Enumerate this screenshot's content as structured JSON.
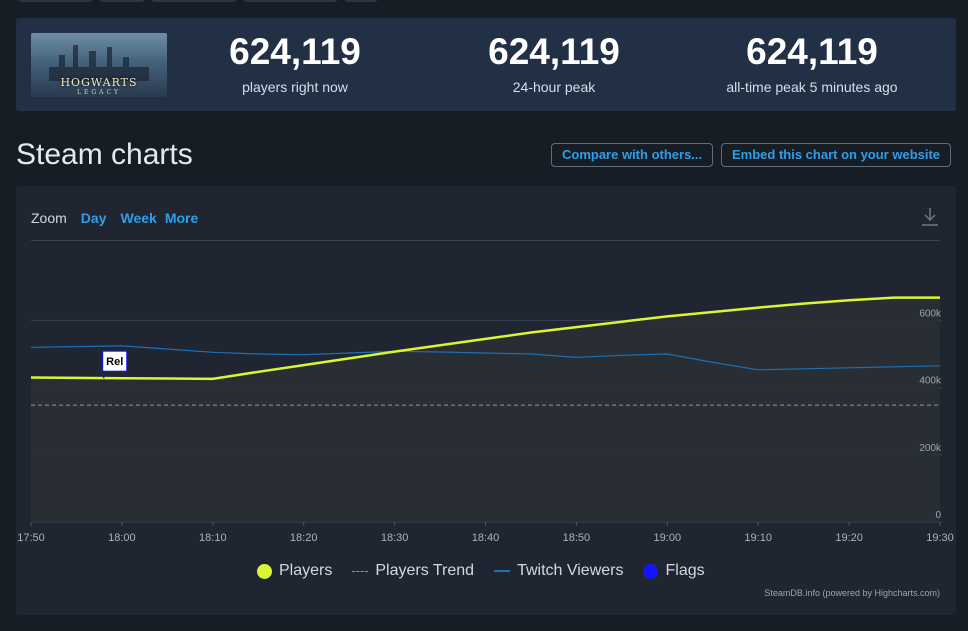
{
  "stats": [
    {
      "value": "624,119",
      "label": "players right now"
    },
    {
      "value": "624,119",
      "label": "24-hour peak"
    },
    {
      "value": "624,119",
      "label": "all-time peak 5 minutes ago"
    }
  ],
  "game": {
    "logo_text": "HOGWARTS",
    "logo_sub": "LEGACY"
  },
  "section_title": "Steam charts",
  "buttons": {
    "compare": "Compare with others...",
    "embed": "Embed this chart on your website"
  },
  "zoom": {
    "label": "Zoom",
    "day": "Day",
    "week": "Week",
    "more": "More"
  },
  "icons": {
    "download": "download-icon"
  },
  "colors": {
    "players": "#d9f533",
    "twitch": "#1d6fb4",
    "trend": "#8b97a3",
    "flags": "#1414ff",
    "accent": "#2f9ee8"
  },
  "chart_data": {
    "type": "line",
    "x": [
      "17:50",
      "17:55",
      "18:00",
      "18:05",
      "18:10",
      "18:15",
      "18:20",
      "18:25",
      "18:30",
      "18:35",
      "18:40",
      "18:45",
      "18:50",
      "18:55",
      "19:00",
      "19:05",
      "19:10",
      "19:15",
      "19:20",
      "19:25",
      "19:30"
    ],
    "series": [
      {
        "name": "Players",
        "values": [
          430000,
          429000,
          428000,
          427000,
          426000,
          447000,
          467000,
          487000,
          507000,
          526000,
          545000,
          564000,
          580000,
          596000,
          612000,
          625000,
          638000,
          650000,
          660000,
          668000,
          624119
        ]
      },
      {
        "name": "Twitch Viewers",
        "values": [
          520000,
          522000,
          524000,
          515000,
          505000,
          500000,
          498000,
          503000,
          508000,
          506000,
          503000,
          500000,
          490000,
          496000,
          500000,
          475000,
          453000,
          456000,
          459000,
          462000,
          465000
        ]
      },
      {
        "name": "Players Trend",
        "values": [
          348000,
          348000,
          348000,
          348000,
          348000,
          348000,
          348000,
          348000,
          348000,
          348000,
          348000,
          348000,
          348000,
          348000,
          348000,
          348000,
          348000,
          348000,
          348000,
          348000,
          348000
        ]
      }
    ],
    "flags": [
      {
        "x": "17:58",
        "label": "Rel"
      }
    ],
    "legend": [
      "Players",
      "Players Trend",
      "Twitch Viewers",
      "Flags"
    ],
    "x_ticks": [
      "17:50",
      "18:00",
      "18:10",
      "18:20",
      "18:30",
      "18:40",
      "18:50",
      "19:00",
      "19:10",
      "19:20",
      "19:30"
    ],
    "y_ticks": [
      "0",
      "200k",
      "400k",
      "600k"
    ],
    "ylim": [
      0,
      750000
    ],
    "grid": true,
    "legend_position": "bottom-center",
    "credit": "SteamDB.info (powered by Highcharts.com)"
  }
}
